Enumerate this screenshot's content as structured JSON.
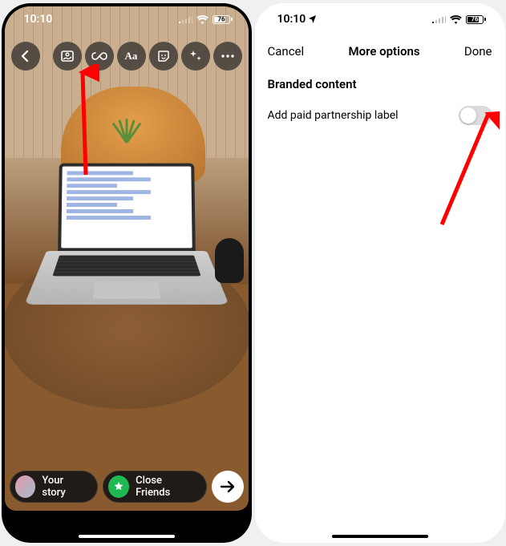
{
  "left": {
    "status": {
      "time": "10:10",
      "battery": "76"
    },
    "icons": {
      "back": "chevron-left-icon",
      "gallery": "gallery-icon",
      "boomerang": "infinity-icon",
      "text": "text-aa-icon",
      "sticker": "sticker-icon",
      "effects": "sparkle-icon",
      "more": "more-dots-icon"
    },
    "share": {
      "your_story": "Your story",
      "close_friends": "Close Friends",
      "send": "send"
    }
  },
  "right": {
    "status": {
      "time": "10:10",
      "battery": "76"
    },
    "nav": {
      "cancel": "Cancel",
      "title": "More options",
      "done": "Done"
    },
    "section_title": "Branded content",
    "row_label": "Add paid partnership label",
    "toggle_on": false
  }
}
